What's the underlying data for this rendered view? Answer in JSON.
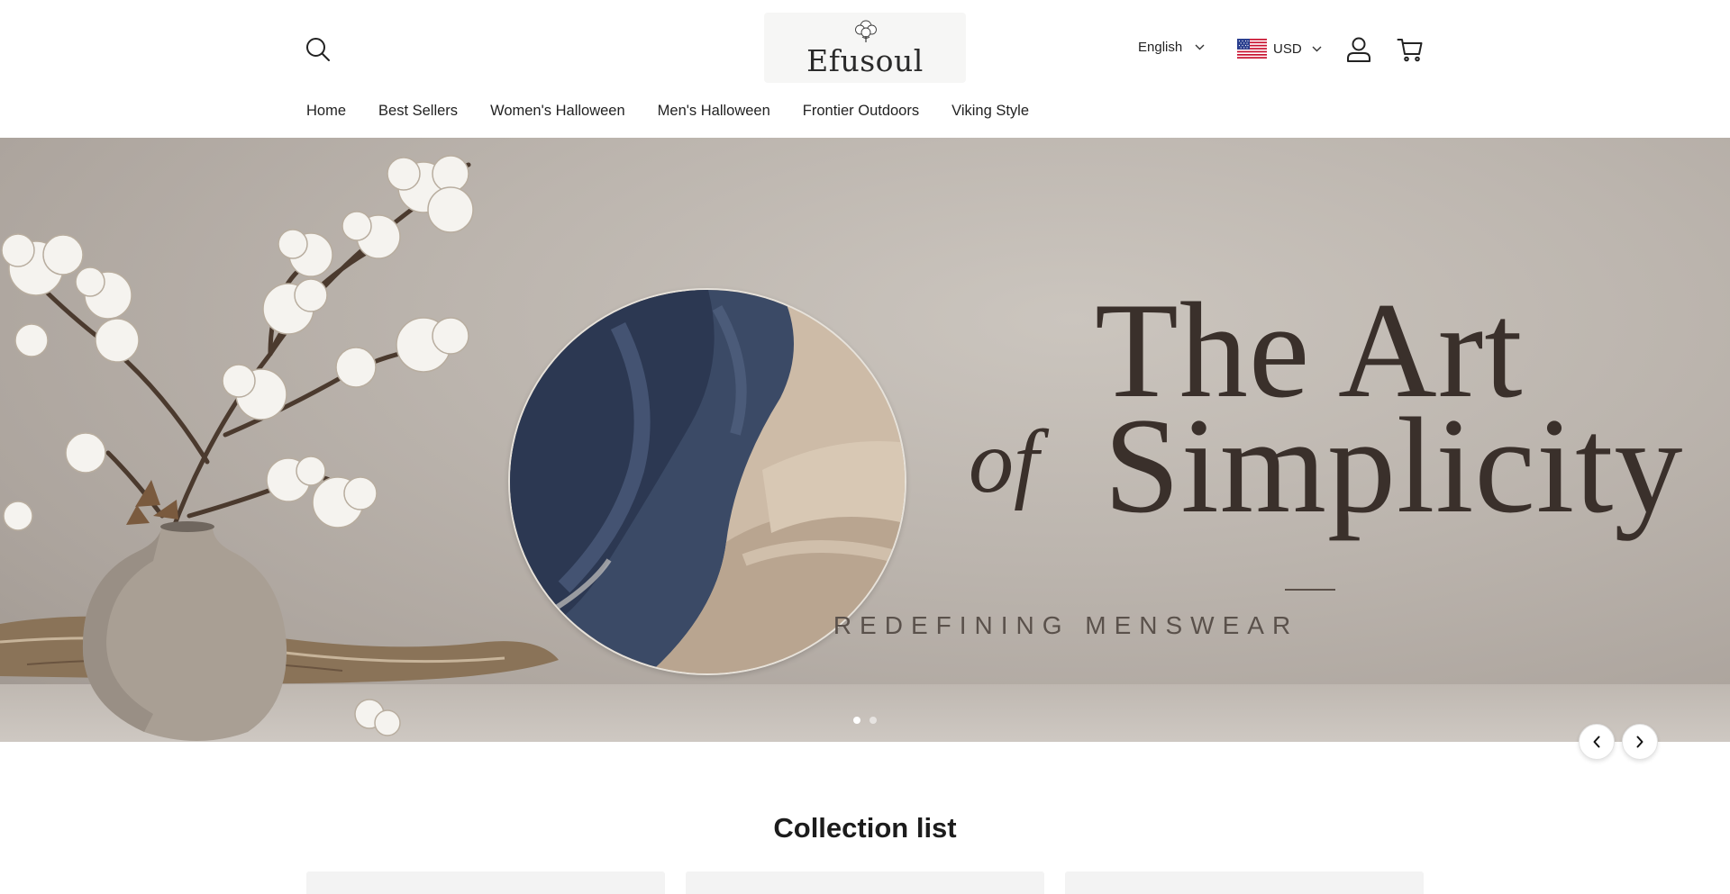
{
  "header": {
    "logo_text": "Efusoul",
    "language": "English",
    "currency": "USD",
    "icons": {
      "search": "search-icon",
      "account": "user-icon",
      "cart": "cart-icon",
      "flag": "us-flag-icon"
    }
  },
  "nav": {
    "items": [
      {
        "label": "Home"
      },
      {
        "label": "Best Sellers"
      },
      {
        "label": "Women's Halloween"
      },
      {
        "label": "Men's Halloween"
      },
      {
        "label": "Frontier Outdoors"
      },
      {
        "label": "Viking Style"
      }
    ]
  },
  "hero": {
    "headline_line1": "The Art",
    "headline_of": "of",
    "headline_line2": "Simplicity",
    "tagline": "REDEFINING MENSWEAR",
    "slides": {
      "count": 2,
      "active": 1
    },
    "prev_icon": "chevron-left-icon",
    "next_icon": "chevron-right-icon"
  },
  "collection": {
    "title": "Collection list",
    "card_count": 3
  },
  "colors": {
    "headline": "#3a302b",
    "hero_background": "#bcb5ae",
    "text": "#1c1c1c"
  }
}
